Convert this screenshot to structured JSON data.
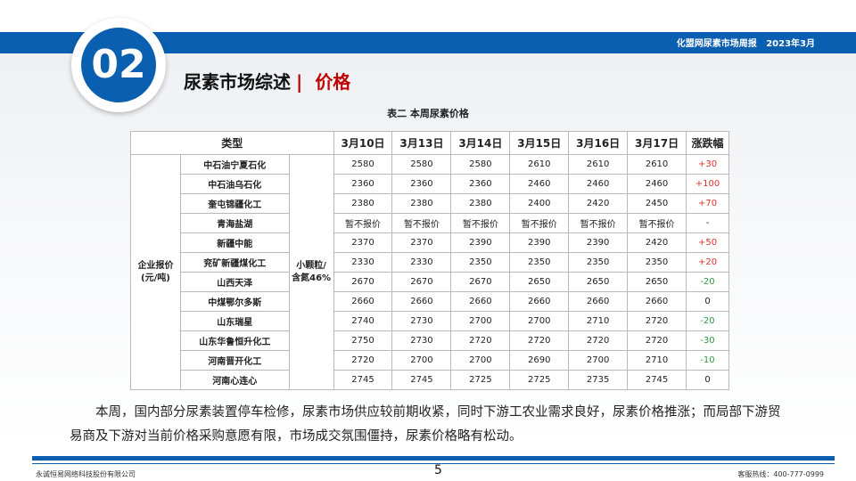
{
  "header": {
    "report_title": "化盟网尿素市场周报",
    "date": "2023年3月",
    "section_number": "02",
    "section_title": "尿素市场综述",
    "section_separator": "|",
    "section_subtitle": "价格"
  },
  "table": {
    "caption": "表二  本周尿素价格",
    "columns": [
      "类型",
      "3月10日",
      "3月13日",
      "3月14日",
      "3月15日",
      "3月16日",
      "3月17日",
      "涨跌幅"
    ],
    "group_label_line1": "企业报价",
    "group_label_line2": "(元/吨)",
    "spec_line1": "小颗粒/",
    "spec_line2": "含氮46%",
    "rows": [
      {
        "company": "中石油宁夏石化",
        "prices": [
          "2580",
          "2580",
          "2580",
          "2610",
          "2610",
          "2610"
        ],
        "change": "+30"
      },
      {
        "company": "中石油乌石化",
        "prices": [
          "2360",
          "2360",
          "2360",
          "2460",
          "2460",
          "2460"
        ],
        "change": "+100"
      },
      {
        "company": "奎屯锦疆化工",
        "prices": [
          "2380",
          "2380",
          "2380",
          "2400",
          "2420",
          "2450"
        ],
        "change": "+70"
      },
      {
        "company": "青海盐湖",
        "prices": [
          "暂不报价",
          "暂不报价",
          "暂不报价",
          "暂不报价",
          "暂不报价",
          "暂不报价"
        ],
        "change": "-"
      },
      {
        "company": "新疆中能",
        "prices": [
          "2370",
          "2370",
          "2390",
          "2390",
          "2390",
          "2420"
        ],
        "change": "+50"
      },
      {
        "company": "兖矿新疆煤化工",
        "prices": [
          "2330",
          "2330",
          "2350",
          "2350",
          "2350",
          "2350"
        ],
        "change": "+20"
      },
      {
        "company": "山西天泽",
        "prices": [
          "2670",
          "2670",
          "2670",
          "2650",
          "2650",
          "2650"
        ],
        "change": "-20"
      },
      {
        "company": "中煤鄂尔多斯",
        "prices": [
          "2660",
          "2660",
          "2660",
          "2660",
          "2660",
          "2660"
        ],
        "change": "0"
      },
      {
        "company": "山东瑞星",
        "prices": [
          "2740",
          "2730",
          "2700",
          "2700",
          "2710",
          "2720"
        ],
        "change": "-20"
      },
      {
        "company": "山东华鲁恒升化工",
        "prices": [
          "2750",
          "2730",
          "2720",
          "2720",
          "2720",
          "2720"
        ],
        "change": "-30"
      },
      {
        "company": "河南晋开化工",
        "prices": [
          "2720",
          "2700",
          "2700",
          "2690",
          "2700",
          "2710"
        ],
        "change": "-10"
      },
      {
        "company": "河南心连心",
        "prices": [
          "2745",
          "2745",
          "2725",
          "2725",
          "2735",
          "2745"
        ],
        "change": "0"
      }
    ]
  },
  "summary": "本周，国内部分尿素装置停车检修，尿素市场供应较前期收紧，同时下游工农业需求良好，尿素价格推涨；而局部下游贸易商及下游对当前价格采购意愿有限，市场成交氛围僵持，尿素价格略有松动。",
  "footer": {
    "company": "永诚恒易网络科技股份有限公司",
    "page": "5",
    "hotline": "客服热线：400-777-0999"
  },
  "colors": {
    "brand_blue": "#0b5fb0",
    "accent_red": "#c00000",
    "up": "#e0312b",
    "down": "#2e9a3e"
  }
}
